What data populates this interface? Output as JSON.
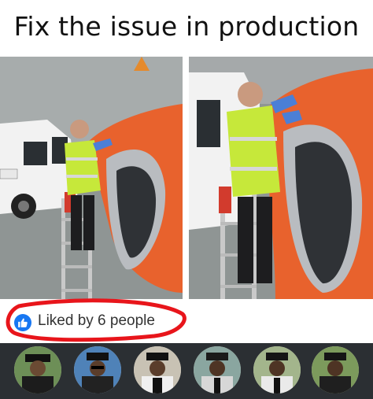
{
  "meme": {
    "caption": "Fix the issue in production"
  },
  "photos": {
    "left": {
      "subject": "man-on-ladder-fixing-engine"
    },
    "right": {
      "subject": "man-on-ladder-fixing-engine-closeup"
    }
  },
  "reactions": {
    "liked_text": "Liked by 6 people",
    "icon": "thumbs-up-icon",
    "circle_color": "#e8151b",
    "icon_color": "#1877f2"
  },
  "avatars": {
    "count": 6,
    "items": [
      {
        "name": "avatar-1"
      },
      {
        "name": "avatar-2"
      },
      {
        "name": "avatar-3"
      },
      {
        "name": "avatar-4"
      },
      {
        "name": "avatar-5"
      },
      {
        "name": "avatar-6"
      }
    ]
  }
}
